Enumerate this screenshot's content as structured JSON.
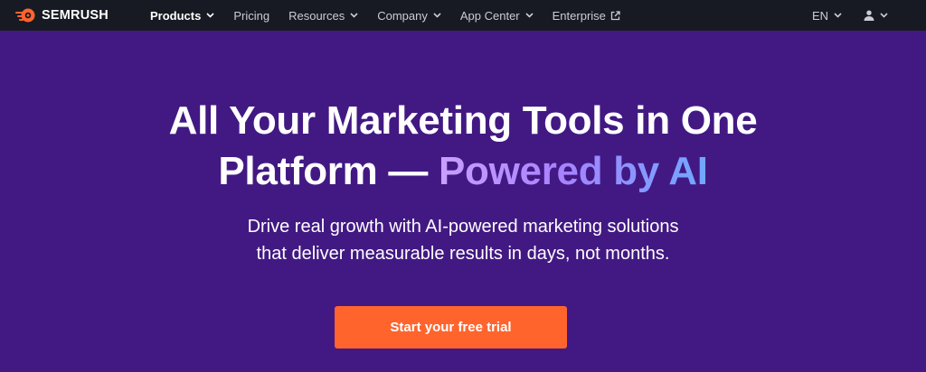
{
  "brand": {
    "name": "SEMRUSH",
    "accent_color": "#ff642d",
    "logo_icon": "semrush-fireball-icon"
  },
  "nav": {
    "items": [
      {
        "label": "Products",
        "active": true,
        "dropdown": true
      },
      {
        "label": "Pricing",
        "active": false,
        "dropdown": false
      },
      {
        "label": "Resources",
        "active": false,
        "dropdown": true
      },
      {
        "label": "Company",
        "active": false,
        "dropdown": true
      },
      {
        "label": "App Center",
        "active": false,
        "dropdown": true
      },
      {
        "label": "Enterprise",
        "active": false,
        "external": true
      }
    ],
    "language": "EN",
    "user_icon": "user-icon"
  },
  "hero": {
    "headline_line1": "All Your Marketing Tools in One",
    "headline_line2_prefix": "Platform —",
    "headline_line2_accent": "Powered by AI",
    "subhead_line1": "Drive real growth with AI-powered marketing solutions",
    "subhead_line2": "that deliver measurable results in days, not months.",
    "cta_label": "Start your free trial",
    "background_color": "#421983",
    "cta_color": "#ff642d"
  }
}
